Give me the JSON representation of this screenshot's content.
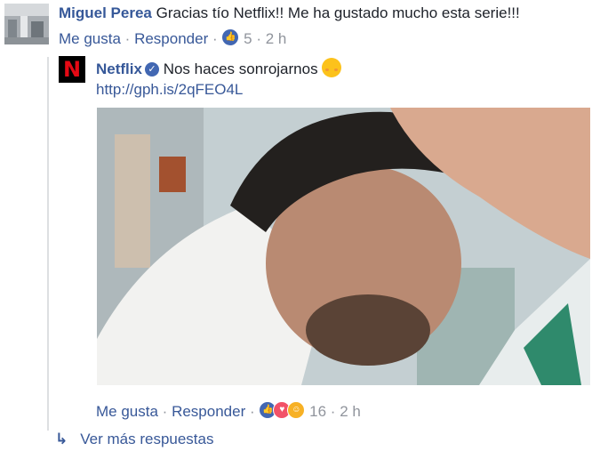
{
  "comment": {
    "author": "Miguel Perea",
    "text": "Gracias tío Netflix!! Me ha gustado mucho esta serie!!!",
    "like_label": "Me gusta",
    "reply_label": "Responder",
    "separator": "·",
    "reaction_count": "5",
    "time": "2 h"
  },
  "reply": {
    "author": "Netflix",
    "avatar_letter": "N",
    "text": "Nos haces sonrojarnos",
    "link": "http://gph.is/2qFEO4L",
    "like_label": "Me gusta",
    "reply_label": "Responder",
    "separator": "·",
    "reaction_count": "16",
    "time": "2 h"
  },
  "more_replies": {
    "arrow": "↳",
    "label": "Ver más respuestas"
  },
  "colors": {
    "link": "#385898",
    "name": "#365899",
    "muted": "#90949c",
    "netflix_red": "#e50914",
    "like_blue": "#4267b2"
  },
  "icons": [
    "avatar",
    "verified-badge-icon",
    "like-reaction-icon",
    "love-reaction-icon",
    "haha-reaction-icon",
    "blush-emoji-icon",
    "reply-arrow-icon"
  ]
}
